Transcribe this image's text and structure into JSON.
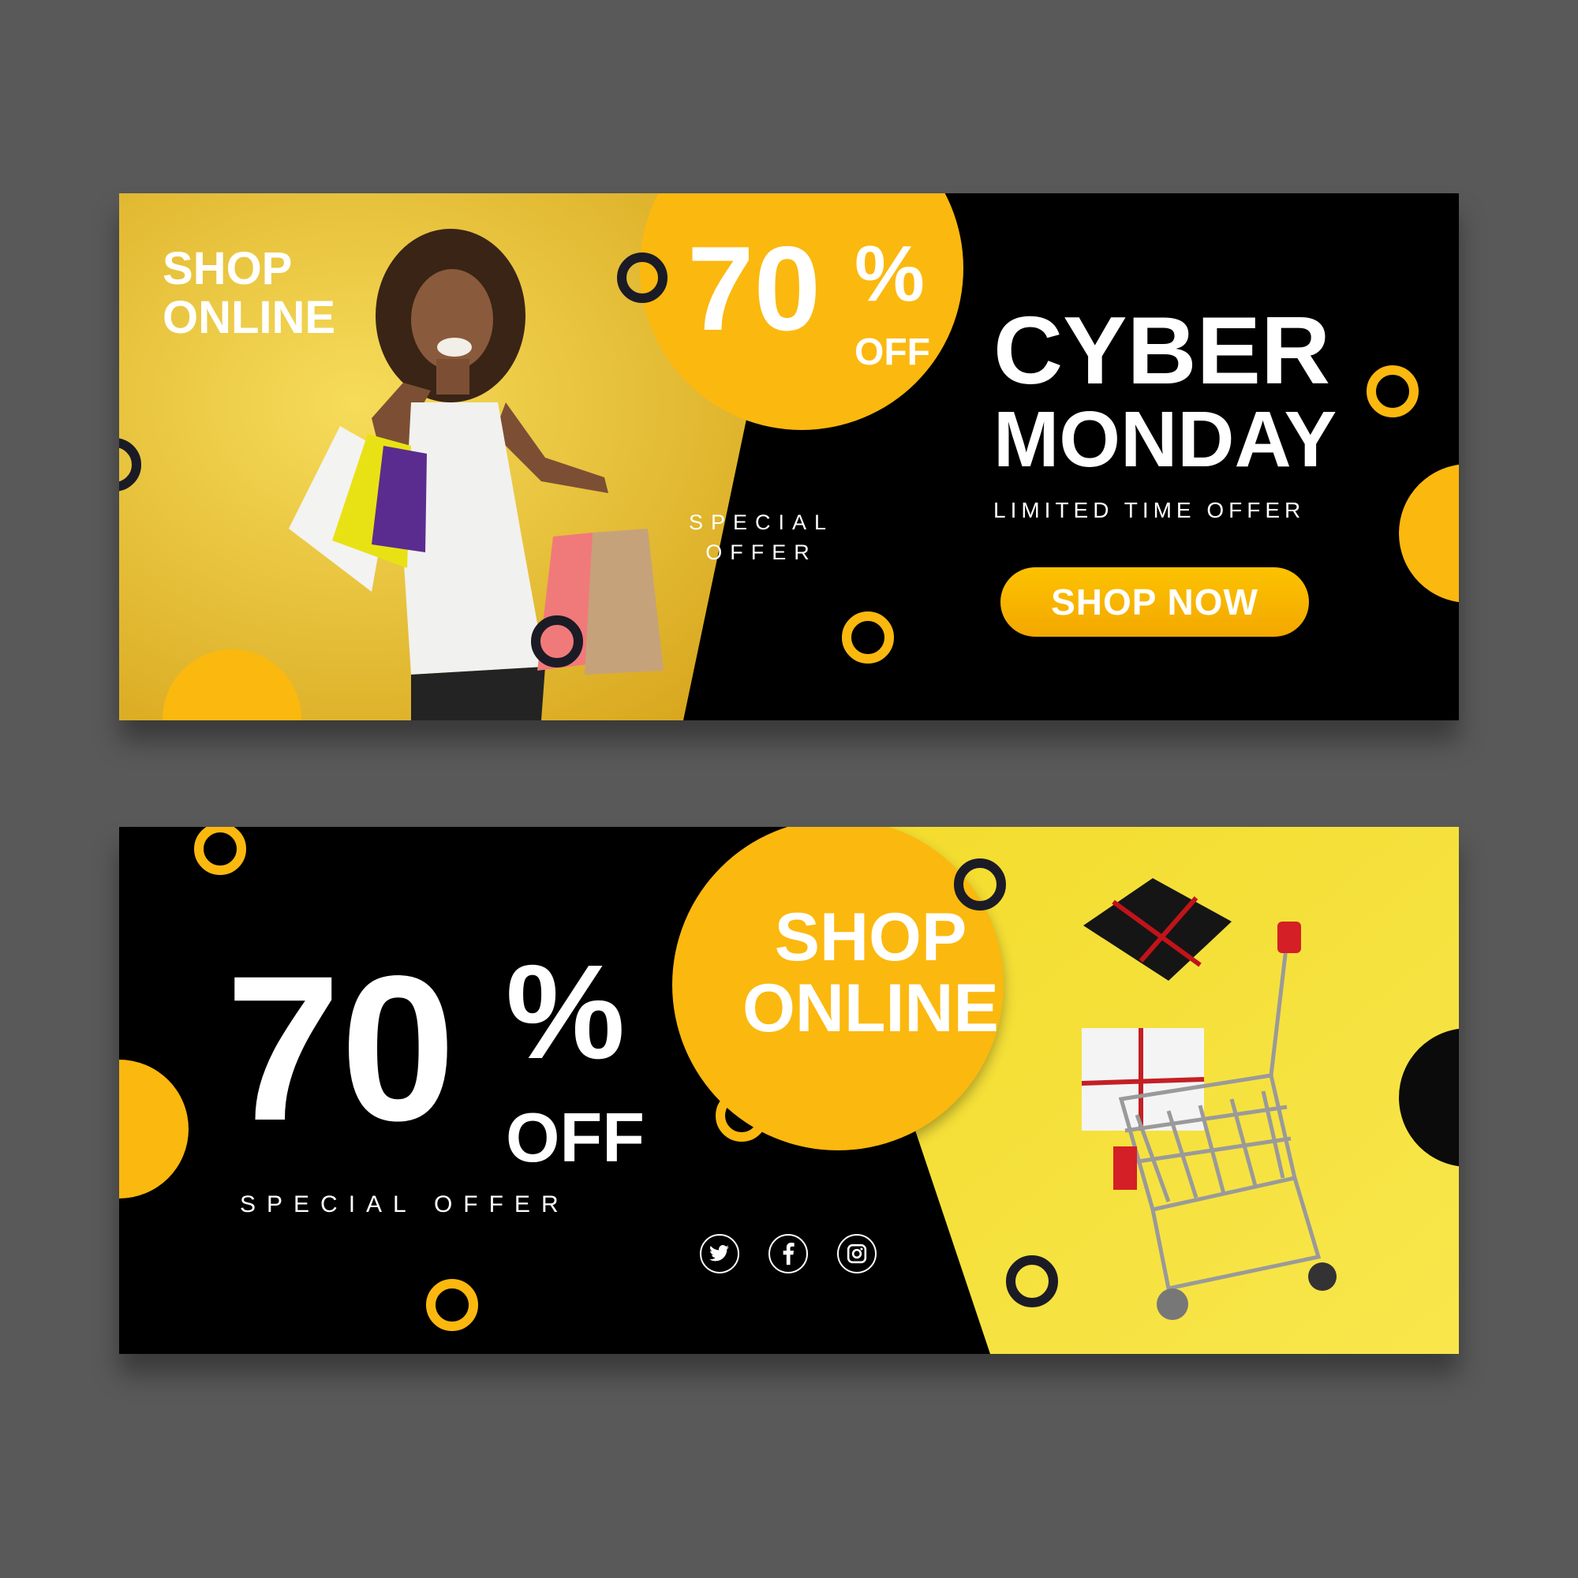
{
  "colors": {
    "accent_yellow": "#fbb80f",
    "dark": "#000000",
    "background": "#595959",
    "text": "#ffffff"
  },
  "banner_top": {
    "shop_online_line1": "SHOP",
    "shop_online_line2": "ONLINE",
    "discount_number": "70",
    "discount_percent": "%",
    "discount_off": "OFF",
    "special_offer_line1": "SPECIAL",
    "special_offer_line2": "OFFER",
    "headline_line1": "CYBER",
    "headline_line2": "MONDAY",
    "tagline": "LIMITED TIME OFFER",
    "cta_label": "SHOP NOW",
    "photo_icon": "woman-with-shopping-bags-photo"
  },
  "banner_bottom": {
    "discount_number": "70",
    "discount_percent": "%",
    "discount_off": "OFF",
    "special_offer": "SPECIAL OFFER",
    "shop_online_line1": "SHOP",
    "shop_online_line2": "ONLINE",
    "social_icons": [
      "twitter-icon",
      "facebook-icon",
      "instagram-icon"
    ],
    "photo_icon": "shopping-cart-with-gifts-photo"
  }
}
